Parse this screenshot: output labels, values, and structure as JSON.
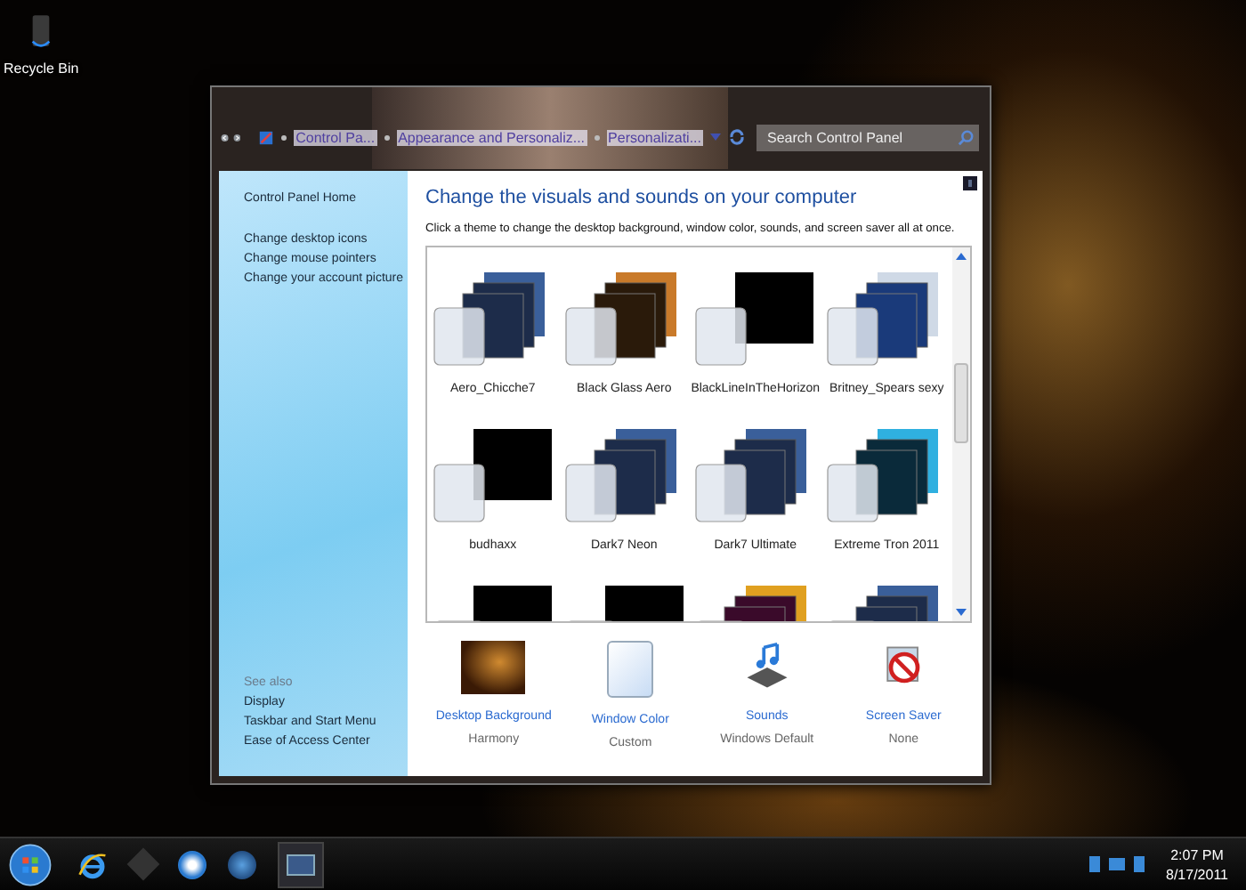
{
  "desktop": {
    "icons": [
      {
        "label": "Recycle Bin"
      }
    ]
  },
  "window": {
    "address": {
      "crumbs": [
        "Control Pa...",
        "Appearance and Personaliz...",
        "Personalizati..."
      ]
    },
    "search": {
      "placeholder": "Search Control Panel"
    },
    "sidebar": {
      "home": "Control Panel Home",
      "links": [
        "Change desktop icons",
        "Change mouse pointers",
        "Change your account picture"
      ],
      "see_also": {
        "heading": "See also",
        "links": [
          "Display",
          "Taskbar and Start Menu",
          "Ease of Access Center"
        ]
      }
    },
    "main": {
      "title": "Change the visuals and sounds on your computer",
      "description": "Click a theme to change the desktop background, window color, sounds, and screen saver all at once.",
      "themes": [
        {
          "name": "Aero_Chicche7",
          "kind": "stack"
        },
        {
          "name": "Black Glass Aero",
          "kind": "warm"
        },
        {
          "name": "BlackLineInTheHorizon",
          "kind": "black"
        },
        {
          "name": "Britney_Spears sexy",
          "kind": "photo"
        },
        {
          "name": "budhaxx",
          "kind": "black"
        },
        {
          "name": "Dark7 Neon",
          "kind": "stack"
        },
        {
          "name": "Dark7 Ultimate",
          "kind": "stack"
        },
        {
          "name": "Extreme Tron 2011",
          "kind": "neon"
        },
        {
          "kind": "black"
        },
        {
          "kind": "black"
        },
        {
          "kind": "colorful"
        },
        {
          "kind": "stack"
        }
      ],
      "settings": [
        {
          "kind": "background",
          "label": "Desktop Background",
          "value": "Harmony"
        },
        {
          "kind": "color",
          "label": "Window Color",
          "value": "Custom"
        },
        {
          "kind": "sounds",
          "label": "Sounds",
          "value": "Windows Default"
        },
        {
          "kind": "screensaver",
          "label": "Screen Saver",
          "value": "None"
        }
      ]
    }
  },
  "taskbar": {
    "time": "2:07 PM",
    "date": "8/17/2011"
  }
}
